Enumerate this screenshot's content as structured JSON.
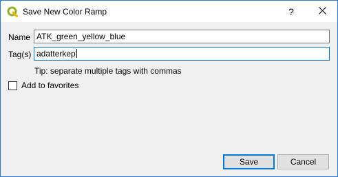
{
  "window": {
    "title": "Save New Color Ramp",
    "app_icon": "qgis-icon",
    "help_label": "?",
    "close_label": "✕"
  },
  "form": {
    "name_label": "Name",
    "name_value": "ATK_green_yellow_blue",
    "tags_label": "Tag(s)",
    "tags_value": "adatterkep",
    "tip_text": "Tip: separate multiple tags with commas",
    "favorites_label": "Add to favorites",
    "favorites_checked": false
  },
  "buttons": {
    "save_label": "Save",
    "cancel_label": "Cancel"
  },
  "colors": {
    "accent": "#0078d7",
    "icon_green": "#93b023"
  }
}
